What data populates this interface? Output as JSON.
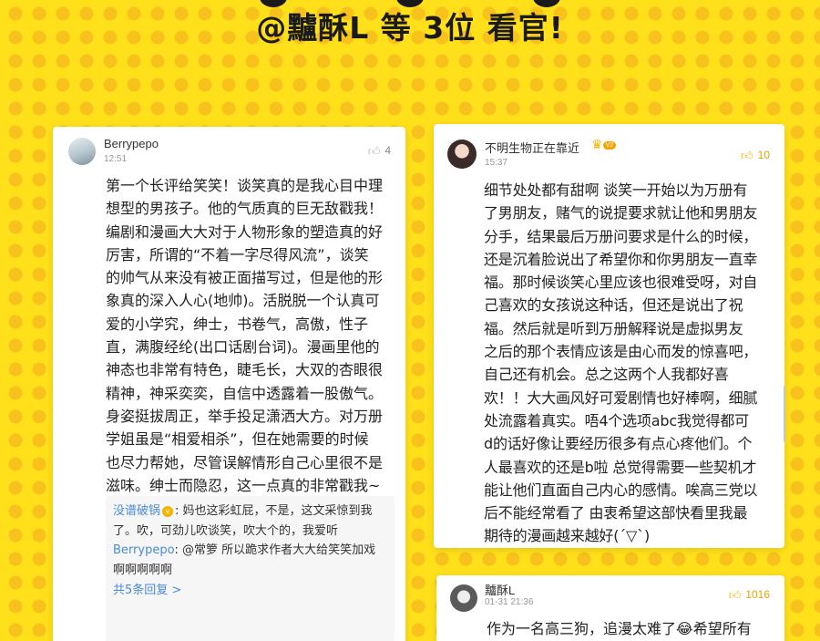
{
  "banner": {
    "title": "@黸酥L 等 3位 看官!"
  },
  "comments": [
    {
      "username": "Berrypepo",
      "time": "12:51",
      "likes": "4",
      "text": "第一个长评给笑笑！谈笑真的是我心目中理\n想型的男孩子。他的气质真的巨无敌戳我！\n编剧和漫画大大对于人物形象的塑造真的好\n厉害，所谓的“不着一字尽得风流”，谈笑\n的帅气从来没有被正面描写过，但是他的形\n象真的深入人心(地帅)。活脱脱一个认真可\n爱的小学究，绅士，书卷气，高傲，性子\n直，满腹经纶(出口话剧台词)。漫画里他的\n神态也非常有特色，睫毛长，大双的杏眼很\n精神，神采奕奕，自信中透露着一股傲气。\n身姿挺拔周正，举手投足潇洒大方。对万册\n学姐虽是“相爱相杀”，但在她需要的时候\n也尽力帮她，尽管误解情形自己心里很不是\n滋味。绅士而隐忍，这一点真的非常戳我~",
      "replies": [
        {
          "author": "没谱破锅",
          "badge": "v",
          "text": "妈也这彩虹屁，不是，这文采惊到我了。吹，可劲儿吹谈笑，吹大个的，我爱听"
        },
        {
          "author": "Berrypepo",
          "text": "@常箩 所以跪求作者大大给笑笑加戏啊啊啊啊啊"
        }
      ],
      "more_replies": "共5条回复 >"
    },
    {
      "username": "不明生物正在靠近",
      "badge_level": "V2",
      "time": "15:37",
      "likes": "10",
      "text": "细节处处都有甜啊  谈笑一开始以为万册有\n了男朋友，赌气的说提要求就让他和男朋友\n分手，结果最后万册问要求是什么的时候，\n还是沉着脸说出了希望你和你男朋友一直幸\n福。那时候谈笑心里应该也很难受呀，对自\n己喜欢的女孩说这种话，但还是说出了祝\n福。然后就是听到万册解释说是虚拟男友\n之后的那个表情应该是由心而发的惊喜吧，\n自己还有机会。总之这两个人我都好喜\n欢！！大大画风好可爱剧情也好棒啊，细腻\n处流露着真实。唔4个选项abc我觉得都可\nd的话好像让要经历很多有点心疼他们。个\n人最喜欢的还是b啦 总觉得需要一些契机才\n能让他们直面自己内心的感情。唉高三党以\n后不能经常看了 由衷希望这部快看里我最\n期待的漫画越来越好(´▽`)"
    },
    {
      "username": "黸酥L",
      "time": "01-31 21:36",
      "likes": "1016",
      "text": "作为一名高三狗，追漫太难了😂希望所有"
    }
  ]
}
